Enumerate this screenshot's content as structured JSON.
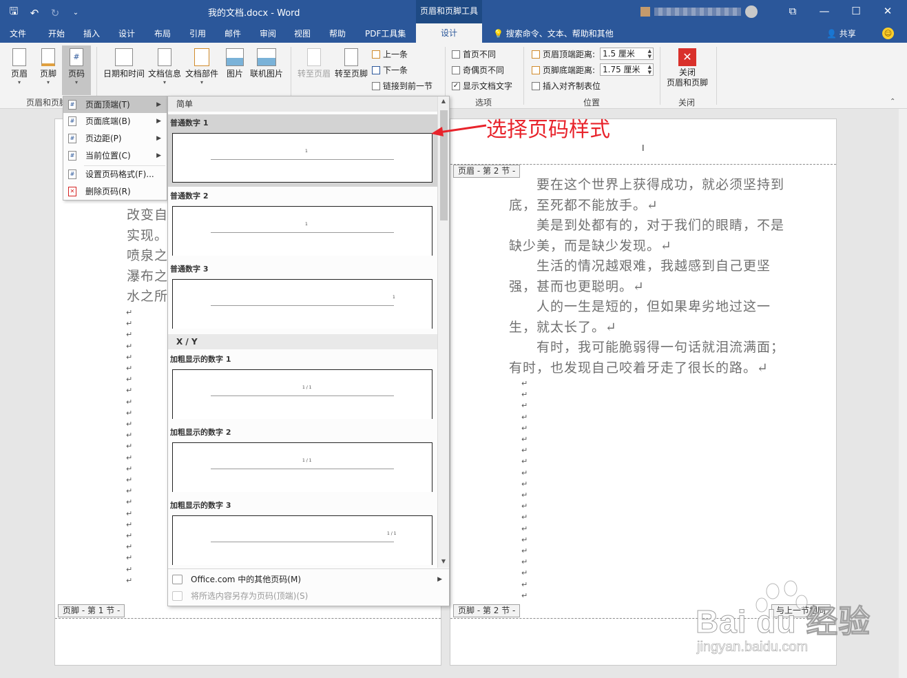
{
  "window": {
    "title": "我的文档.docx  -  Word",
    "context_tab_group": "页眉和页脚工具",
    "controls": {
      "ribbon_display": "⧉",
      "minimize": "—",
      "maximize": "☐",
      "close": "✕"
    }
  },
  "tabs": [
    "文件",
    "开始",
    "插入",
    "设计",
    "布局",
    "引用",
    "邮件",
    "审阅",
    "视图",
    "帮助",
    "PDF工具集"
  ],
  "active_tab": "设计",
  "tell_me": "搜索命令、文本、帮助和其他",
  "share": "共享",
  "ribbon": {
    "header_footer_group": {
      "header": "页眉",
      "footer": "页脚",
      "page_number": "页码",
      "label": "页眉和页脚"
    },
    "insert_group": {
      "datetime": "日期和时间",
      "docinfo": "文档信息",
      "quickparts": "文档部件",
      "picture": "图片",
      "online_picture": "联机图片"
    },
    "navigation_group": {
      "goto_header": "转至页眉",
      "goto_footer": "转至页脚",
      "previous": "上一条",
      "next": "下一条",
      "link_previous": "链接到前一节"
    },
    "options_group": {
      "first_page": "首页不同",
      "odd_even": "奇偶页不同",
      "show_text": "显示文档文字",
      "show_text_checked": true,
      "label": "选项"
    },
    "position_group": {
      "header_top_label": "页眉顶端距离:",
      "header_top_value": "1.5 厘米",
      "footer_bottom_label": "页脚底端距离:",
      "footer_bottom_value": "1.75 厘米",
      "insert_align_tab": "插入对齐制表位",
      "label": "位置"
    },
    "close_group": {
      "close": "关闭页眉和页脚",
      "close_line1": "关闭",
      "close_line2": "页眉和页脚",
      "label": "关闭"
    }
  },
  "page_number_menu": [
    {
      "label": "页面顶端(T)",
      "has_sub": true
    },
    {
      "label": "页面底端(B)",
      "has_sub": true
    },
    {
      "label": "页边距(P)",
      "has_sub": true
    },
    {
      "label": "当前位置(C)",
      "has_sub": true
    },
    {
      "label": "设置页码格式(F)...",
      "has_sub": false
    },
    {
      "label": "删除页码(R)",
      "has_sub": false
    }
  ],
  "gallery": {
    "section_simple": "简单",
    "section_xy": "X / Y",
    "items": [
      {
        "label": "普通数字 1",
        "preview": "1",
        "align": "center"
      },
      {
        "label": "普通数字 2",
        "preview": "1",
        "align": "center"
      },
      {
        "label": "普通数字 3",
        "preview": "1",
        "align": "right"
      },
      {
        "label": "加粗显示的数字 1",
        "preview": "1 / 1",
        "align": "center"
      },
      {
        "label": "加粗显示的数字 2",
        "preview": "1 / 1",
        "align": "center"
      },
      {
        "label": "加粗显示的数字 3",
        "preview": "1 / 1",
        "align": "right"
      }
    ],
    "more_online": "Office.com 中的其他页码(M)",
    "save_selection": "将所选内容另存为页码(顶端)(S)"
  },
  "annotation": "选择页码样式",
  "document": {
    "left_page_lines": [
      "改变自",
      "实现。",
      "喷泉之",
      "瀑布之",
      "水之所"
    ],
    "left_footer_tag": "页脚 - 第 1 节 -",
    "right_header_tag": "页眉 - 第 2 节 -",
    "right_footer_tag": "页脚 - 第 2 节 -",
    "right_footer_same": "与上一节相同",
    "right_paragraphs": [
      "　　要在这个世界上获得成功，就必须坚持到底，至死都不能放手。↵",
      "　　美是到处都有的，对于我们的眼睛，不是缺少美，而是缺少发现。↵",
      "　　生活的情况越艰难，我越感到自己更坚强，甚而也更聪明。↵",
      "　　人的一生是短的，但如果卑劣地过这一生，就太长了。↵",
      "　　有时，我可能脆弱得一句话就泪流满面；有时，也发现自己咬着牙走了很长的路。↵"
    ]
  },
  "watermark": {
    "brand": "Bai du 经验",
    "url": "jingyan.baidu.com"
  }
}
